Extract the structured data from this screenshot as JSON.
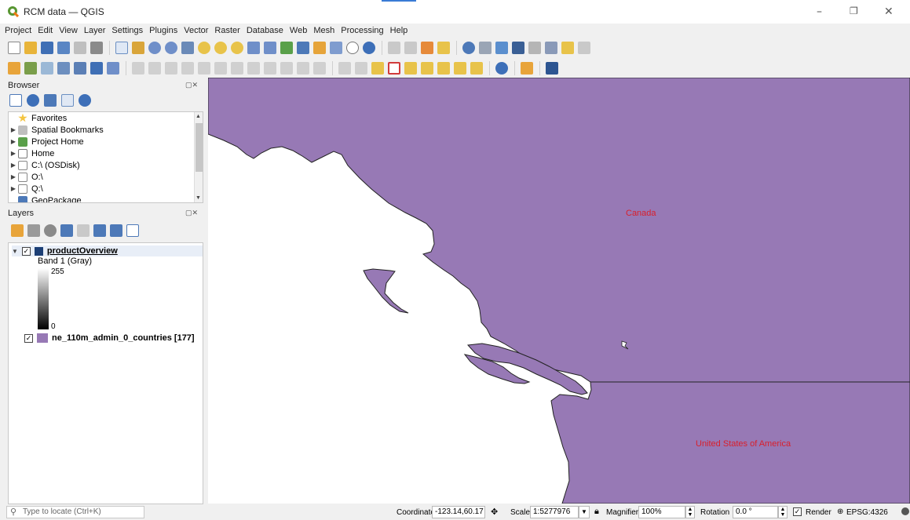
{
  "window": {
    "title": "RCM data — QGIS"
  },
  "menu": [
    "Project",
    "Edit",
    "View",
    "Layer",
    "Settings",
    "Plugins",
    "Vector",
    "Raster",
    "Database",
    "Web",
    "Mesh",
    "Processing",
    "Help"
  ],
  "browser": {
    "title": "Browser",
    "items": [
      {
        "label": "Favorites",
        "icon": "star-icon",
        "expand": false
      },
      {
        "label": "Spatial Bookmarks",
        "icon": "bookmark-icon",
        "expand": true
      },
      {
        "label": "Project Home",
        "icon": "project-home-icon",
        "expand": true
      },
      {
        "label": "Home",
        "icon": "home-folder-icon",
        "expand": true
      },
      {
        "label": "C:\\ (OSDisk)",
        "icon": "folder-icon",
        "expand": true
      },
      {
        "label": "O:\\",
        "icon": "folder-icon",
        "expand": true
      },
      {
        "label": "Q:\\",
        "icon": "folder-icon",
        "expand": true
      },
      {
        "label": "GeoPackage",
        "icon": "geopackage-icon",
        "expand": false
      }
    ]
  },
  "layers": {
    "title": "Layers",
    "raster": {
      "name": "productOverview",
      "band": "Band 1 (Gray)",
      "max": "255",
      "min": "0"
    },
    "vector": {
      "name": "ne_110m_admin_0_countries [177]",
      "color": "#9779b5"
    }
  },
  "map": {
    "fill": "#9779b5",
    "labels": {
      "canada": "Canada",
      "usa": "United States of America"
    },
    "label_color": "#d91f2b"
  },
  "status": {
    "locate_placeholder": "Type to locate (Ctrl+K)",
    "coordinate_label": "Coordinate",
    "coordinate": "-123.14,60.17",
    "scale_label": "Scale",
    "scale": "1:5277976",
    "magnifier_label": "Magnifier",
    "magnifier": "100%",
    "rotation_label": "Rotation",
    "rotation": "0.0 °",
    "render_label": "Render",
    "crs": "EPSG:4326"
  }
}
